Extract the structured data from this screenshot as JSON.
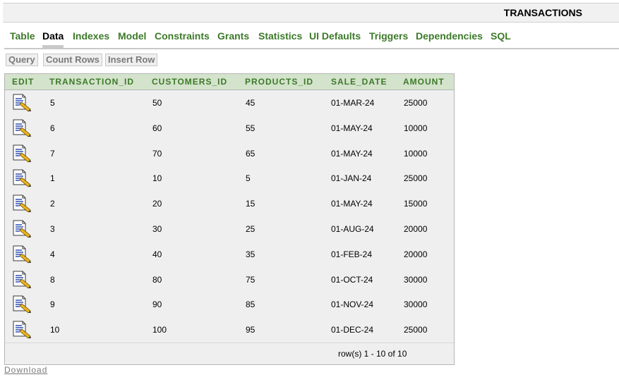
{
  "window": {
    "title": "TRANSACTIONS"
  },
  "tabs": [
    {
      "label": "Table"
    },
    {
      "label": "Data",
      "active": true
    },
    {
      "label": "Indexes"
    },
    {
      "label": "Model"
    },
    {
      "label": "Constraints"
    },
    {
      "label": "Grants"
    },
    {
      "label": "Statistics"
    },
    {
      "label": "UI Defaults"
    },
    {
      "label": "Triggers"
    },
    {
      "label": "Dependencies"
    },
    {
      "label": "SQL"
    }
  ],
  "toolbar": {
    "query_label": "Query",
    "count_rows_label": "Count Rows",
    "insert_row_label": "Insert Row"
  },
  "table": {
    "headers": [
      "EDIT",
      "TRANSACTION_ID",
      "CUSTOMERS_ID",
      "PRODUCTS_ID",
      "SALE_DATE",
      "AMOUNT"
    ],
    "edit_icon": "edit-document-pencil-icon",
    "rows": [
      {
        "transaction_id": "5",
        "customers_id": "50",
        "products_id": "45",
        "sale_date": "01-MAR-24",
        "amount": "25000"
      },
      {
        "transaction_id": "6",
        "customers_id": "60",
        "products_id": "55",
        "sale_date": "01-MAY-24",
        "amount": "10000"
      },
      {
        "transaction_id": "7",
        "customers_id": "70",
        "products_id": "65",
        "sale_date": "01-MAY-24",
        "amount": "10000"
      },
      {
        "transaction_id": "1",
        "customers_id": "10",
        "products_id": "5",
        "sale_date": "01-JAN-24",
        "amount": "25000"
      },
      {
        "transaction_id": "2",
        "customers_id": "20",
        "products_id": "15",
        "sale_date": "01-MAY-24",
        "amount": "15000"
      },
      {
        "transaction_id": "3",
        "customers_id": "30",
        "products_id": "25",
        "sale_date": "01-AUG-24",
        "amount": "20000"
      },
      {
        "transaction_id": "4",
        "customers_id": "40",
        "products_id": "35",
        "sale_date": "01-FEB-24",
        "amount": "20000"
      },
      {
        "transaction_id": "8",
        "customers_id": "80",
        "products_id": "75",
        "sale_date": "01-OCT-24",
        "amount": "30000"
      },
      {
        "transaction_id": "9",
        "customers_id": "90",
        "products_id": "85",
        "sale_date": "01-NOV-24",
        "amount": "30000"
      },
      {
        "transaction_id": "10",
        "customers_id": "100",
        "products_id": "95",
        "sale_date": "01-DEC-24",
        "amount": "25000"
      }
    ],
    "row_count_text": "row(s) 1 - 10 of 10"
  },
  "download_label": "Download",
  "colors": {
    "tab_link": "#3c7a29",
    "header_bg": "#d4e3cc",
    "row_bg": "#efefef"
  }
}
